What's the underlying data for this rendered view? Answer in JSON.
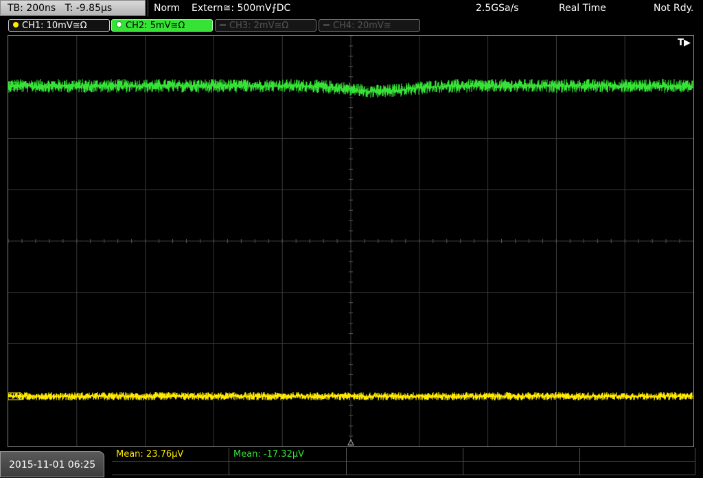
{
  "top": {
    "timebase": "TB: 200ns",
    "trigger_time": "T: -9.85µs",
    "mode": "Norm",
    "trigger_source": "Extern≅: 500mV⨍DC",
    "sample_rate": "2.5GSa/s",
    "acq_mode": "Real Time",
    "status": "Not Rdy."
  },
  "channels": [
    {
      "label": "CH1: 10mV≅Ω",
      "color": "#ffea00",
      "active": true
    },
    {
      "label": "CH2: 5mV≅Ω",
      "color": "#35e235",
      "active": true,
      "selected": true
    },
    {
      "label": "CH3: 2mV≅Ω",
      "color": "#555555",
      "active": false
    },
    {
      "label": "CH4: 20mV≅",
      "color": "#555555",
      "active": false
    }
  ],
  "trigger_marker": "T▶",
  "date": "2015-11-01 06:25",
  "measurements": [
    {
      "label": "Mean: 23.76µV",
      "color": "#ffea00"
    },
    {
      "label": "Mean: -17.32µV",
      "color": "#35e235"
    }
  ],
  "colors": {
    "ch1": "#ffea00",
    "ch2": "#35e235",
    "grid": "#3a3a3a"
  }
}
